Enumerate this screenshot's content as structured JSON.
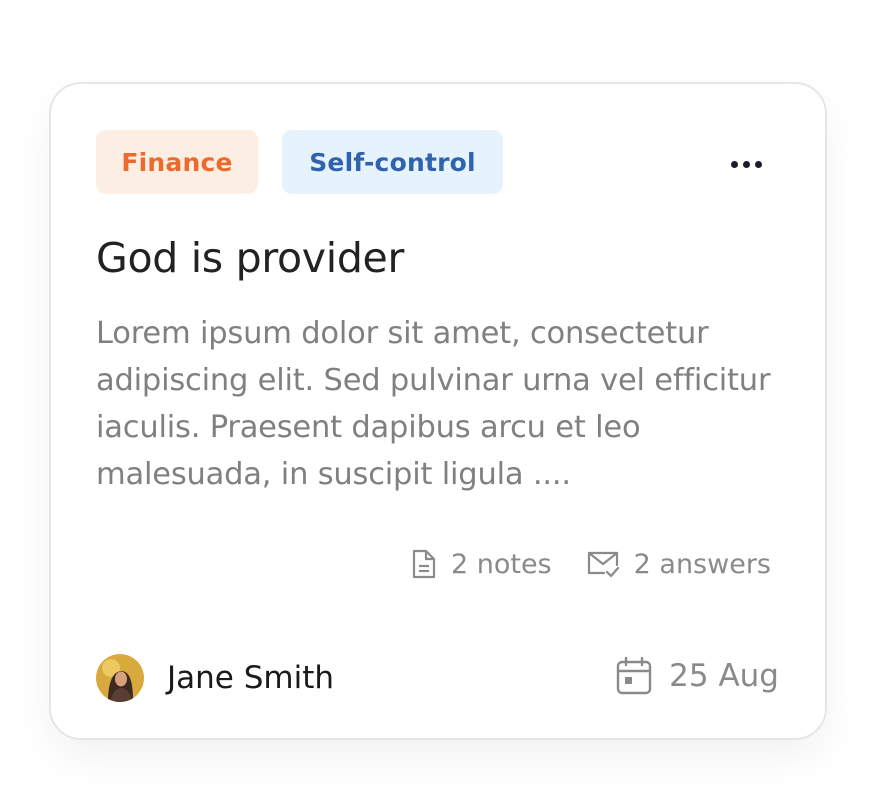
{
  "card": {
    "tags": [
      {
        "label": "Finance",
        "bg": "#fdeee3",
        "color": "#ec6a2c"
      },
      {
        "label": "Self-control",
        "bg": "#e6f3fc",
        "color": "#2f63ad"
      }
    ],
    "more_icon": "more-horizontal-icon",
    "title": "God is provider",
    "description": "Lorem ipsum dolor sit amet, consectetur adipiscing elit. Sed pulvinar urna vel efficitur iaculis. Praesent dapibus arcu et leo malesuada, in suscipit ligula ....",
    "stats": {
      "notes": {
        "icon": "document-icon",
        "label": "2 notes"
      },
      "answers": {
        "icon": "mail-check-icon",
        "label": "2 answers"
      }
    },
    "author": {
      "name": "Jane Smith",
      "avatar_icon": "avatar"
    },
    "date": {
      "icon": "calendar-icon",
      "label": "25 Aug"
    }
  }
}
